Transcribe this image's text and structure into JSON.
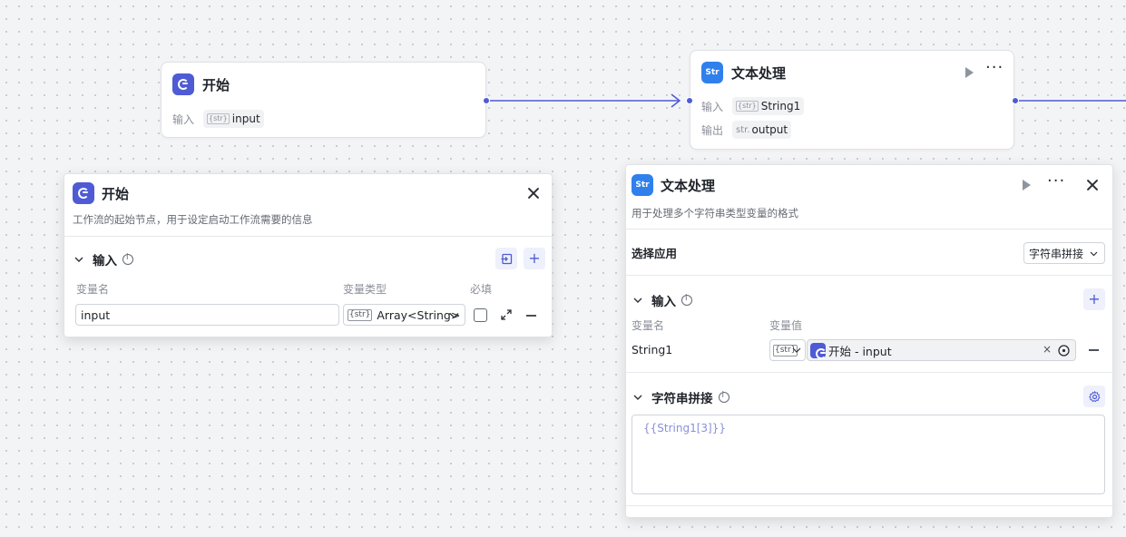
{
  "canvas": {
    "start_node": {
      "title": "开始",
      "input_label": "输入",
      "input_tag": "{str}",
      "input_value": "input"
    },
    "text_node": {
      "title": "文本处理",
      "icon_text": "Str",
      "input_label": "输入",
      "input_tag": "{str}",
      "input_value": "String1",
      "output_label": "输出",
      "output_tag": "str.",
      "output_value": "output"
    }
  },
  "start_panel": {
    "title": "开始",
    "description": "工作流的起始节点，用于设定启动工作流需要的信息",
    "section_title": "输入",
    "col_name": "变量名",
    "col_type": "变量类型",
    "col_required": "必填",
    "row": {
      "name": "input",
      "type_tag": "{str}",
      "type_value": "Array<String>"
    }
  },
  "text_panel": {
    "title": "文本处理",
    "icon_text": "Str",
    "description": "用于处理多个字符串类型变量的格式",
    "select_app_label": "选择应用",
    "select_app_value": "字符串拼接",
    "input_section_title": "输入",
    "col_name": "变量名",
    "col_value": "变量值",
    "row": {
      "name": "String1",
      "type_tag": "{str}",
      "ref_value": "开始 - input"
    },
    "concat_section_title": "字符串拼接",
    "template_text": "{{String1[3]}}"
  },
  "colors": {
    "accent": "#4e5bd4",
    "text_icon": "#2f80ed",
    "edge": "#4e5bd4"
  }
}
